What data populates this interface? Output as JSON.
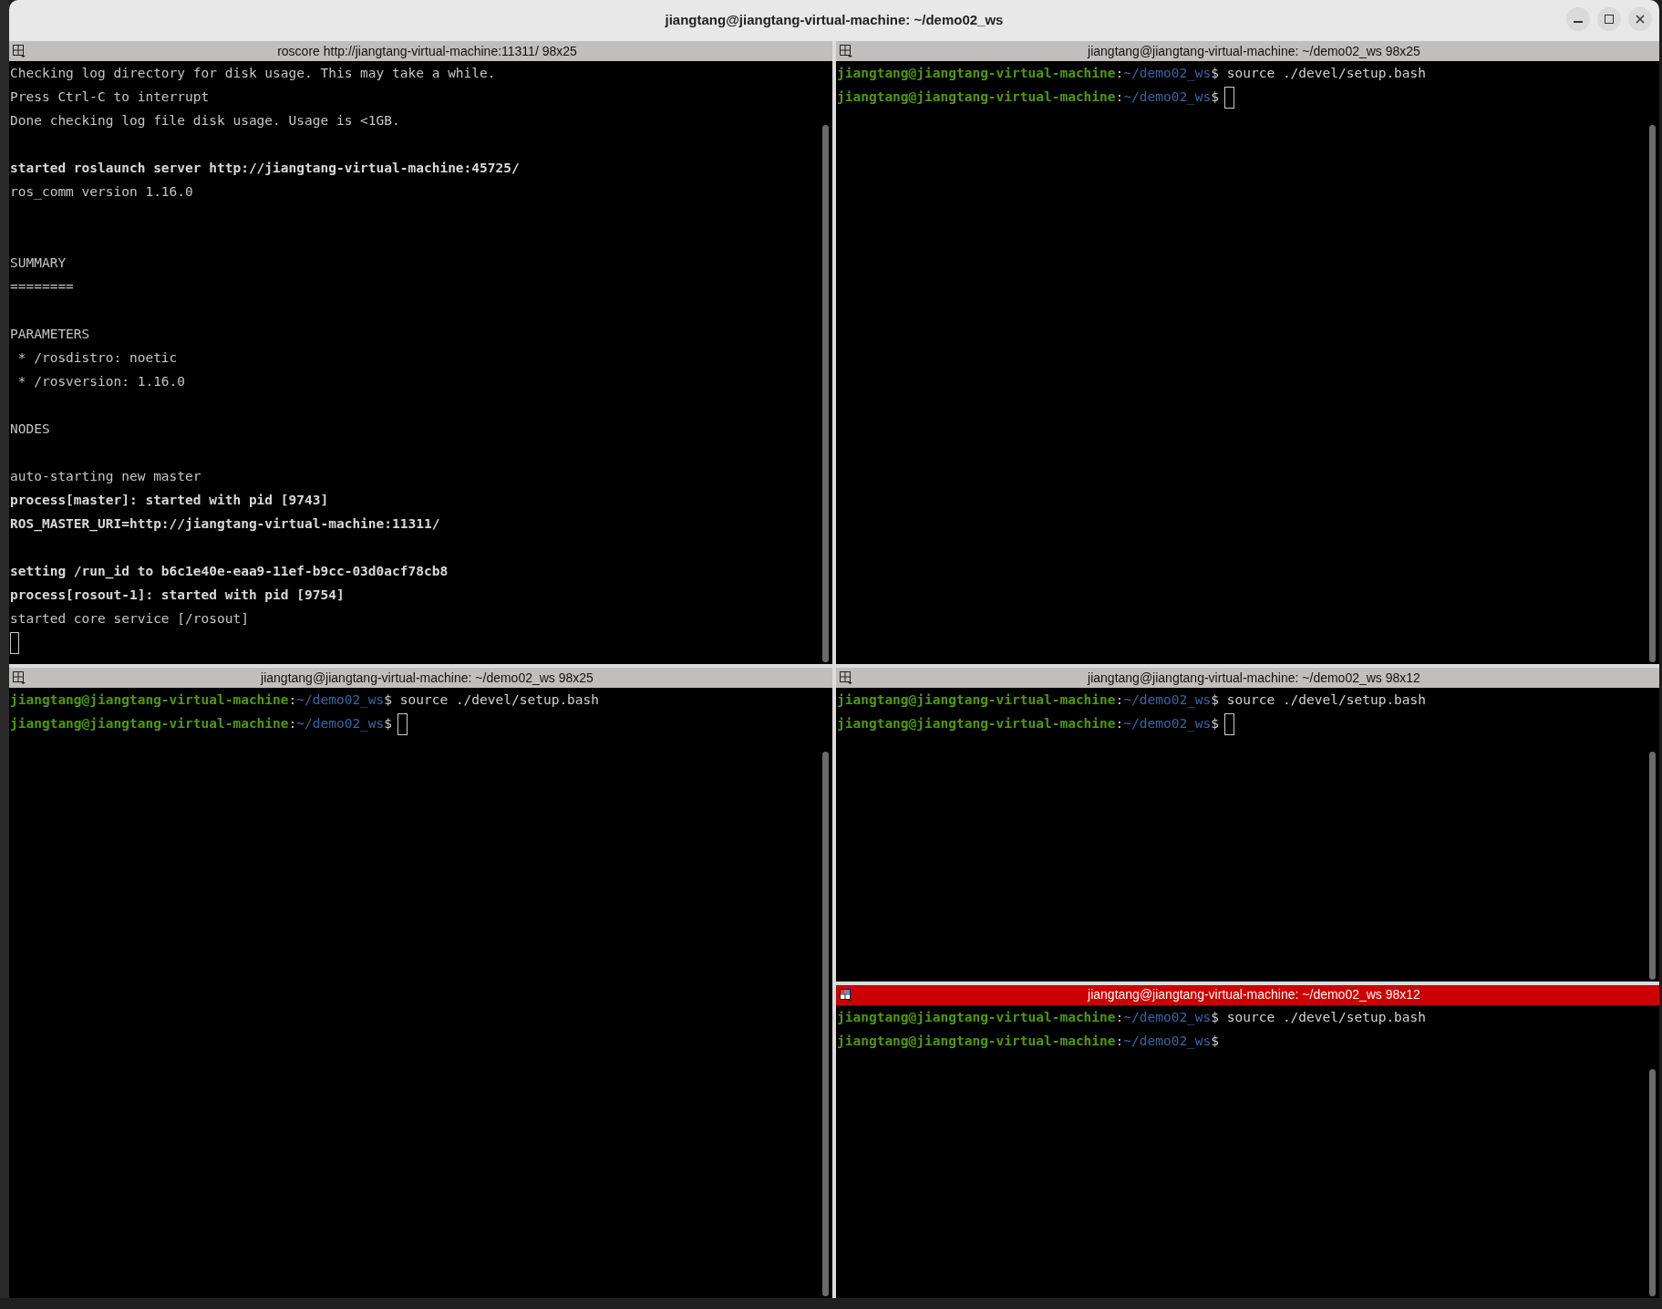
{
  "window": {
    "title": "jiangtang@jiangtang-virtual-machine: ~/demo02_ws"
  },
  "columns": [
    {
      "panes": [
        {
          "title": "roscore http://jiangtang-virtual-machine:11311/ 98x25",
          "selected": false,
          "lines": [
            {
              "kind": "text",
              "text": "Checking log directory for disk usage. This may take a while.",
              "bold": false
            },
            {
              "kind": "text",
              "text": "Press Ctrl-C to interrupt",
              "bold": false
            },
            {
              "kind": "text",
              "text": "Done checking log file disk usage. Usage is <1GB.",
              "bold": false
            },
            {
              "kind": "blank"
            },
            {
              "kind": "text",
              "text": "started roslaunch server http://jiangtang-virtual-machine:45725/",
              "bold": true
            },
            {
              "kind": "text",
              "text": "ros_comm version 1.16.0",
              "bold": false
            },
            {
              "kind": "blank"
            },
            {
              "kind": "blank"
            },
            {
              "kind": "text",
              "text": "SUMMARY",
              "bold": false
            },
            {
              "kind": "text",
              "text": "========",
              "bold": false
            },
            {
              "kind": "blank"
            },
            {
              "kind": "text",
              "text": "PARAMETERS",
              "bold": false
            },
            {
              "kind": "text",
              "text": " * /rosdistro: noetic",
              "bold": false
            },
            {
              "kind": "text",
              "text": " * /rosversion: 1.16.0",
              "bold": false
            },
            {
              "kind": "blank"
            },
            {
              "kind": "text",
              "text": "NODES",
              "bold": false
            },
            {
              "kind": "blank"
            },
            {
              "kind": "text",
              "text": "auto-starting new master",
              "bold": false
            },
            {
              "kind": "text",
              "text": "process[master]: started with pid [9743]",
              "bold": true
            },
            {
              "kind": "text",
              "text": "ROS_MASTER_URI=http://jiangtang-virtual-machine:11311/",
              "bold": true
            },
            {
              "kind": "blank"
            },
            {
              "kind": "text",
              "text": "setting /run_id to b6c1e40e-eaa9-11ef-b9cc-03d0acf78cb8",
              "bold": true
            },
            {
              "kind": "text",
              "text": "process[rosout-1]: started with pid [9754]",
              "bold": true
            },
            {
              "kind": "text",
              "text": "started core service [/rosout]",
              "bold": false
            },
            {
              "kind": "cursor"
            }
          ]
        },
        {
          "title": "jiangtang@jiangtang-virtual-machine: ~/demo02_ws 98x25",
          "selected": false,
          "lines": [
            {
              "kind": "prompt",
              "user": "jiangtang@jiangtang-virtual-machine",
              "sep": ":",
              "path": "~/demo02_ws",
              "dollar": "$",
              "command": "source ./devel/setup.bash",
              "cursor": false
            },
            {
              "kind": "prompt",
              "user": "jiangtang@jiangtang-virtual-machine",
              "sep": ":",
              "path": "~/demo02_ws",
              "dollar": "$",
              "cursor": true
            }
          ]
        }
      ]
    },
    {
      "panes": [
        {
          "title": "jiangtang@jiangtang-virtual-machine: ~/demo02_ws 98x25",
          "selected": false,
          "lines": [
            {
              "kind": "prompt",
              "user": "jiangtang@jiangtang-virtual-machine",
              "sep": ":",
              "path": "~/demo02_ws",
              "dollar": "$",
              "command": "source ./devel/setup.bash",
              "cursor": false
            },
            {
              "kind": "prompt",
              "user": "jiangtang@jiangtang-virtual-machine",
              "sep": ":",
              "path": "~/demo02_ws",
              "dollar": "$",
              "cursor": true
            }
          ]
        },
        {
          "title": "jiangtang@jiangtang-virtual-machine: ~/demo02_ws 98x12",
          "selected": false,
          "lines": [
            {
              "kind": "prompt",
              "user": "jiangtang@jiangtang-virtual-machine",
              "sep": ":",
              "path": "~/demo02_ws",
              "dollar": "$",
              "command": "source ./devel/setup.bash",
              "cursor": false
            },
            {
              "kind": "prompt",
              "user": "jiangtang@jiangtang-virtual-machine",
              "sep": ":",
              "path": "~/demo02_ws",
              "dollar": "$",
              "cursor": true
            }
          ]
        },
        {
          "title": "jiangtang@jiangtang-virtual-machine: ~/demo02_ws 98x12",
          "selected": true,
          "lines": [
            {
              "kind": "prompt",
              "user": "jiangtang@jiangtang-virtual-machine",
              "sep": ":",
              "path": "~/demo02_ws",
              "dollar": "$",
              "command": "source ./devel/setup.bash",
              "cursor": false
            },
            {
              "kind": "prompt",
              "user": "jiangtang@jiangtang-virtual-machine",
              "sep": ":",
              "path": "~/demo02_ws",
              "dollar": "$",
              "cursor": false
            }
          ]
        }
      ]
    }
  ]
}
